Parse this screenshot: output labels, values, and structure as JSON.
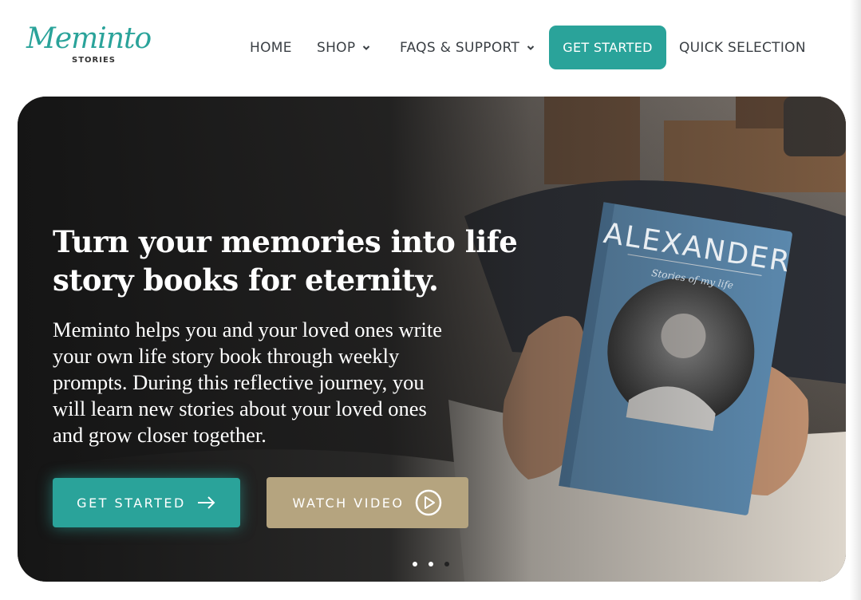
{
  "brand": {
    "logo_script": "Meminto",
    "logo_sub": "STORIES"
  },
  "nav": {
    "home": "HOME",
    "shop": "SHOP",
    "faqs": "FAQS & SUPPORT",
    "get_started": "GET STARTED",
    "quick_selection": "QUICK SELECTION"
  },
  "hero": {
    "title_line1": "Turn your memories into life",
    "title_line2": "story books for eternity.",
    "desc_lines": [
      "Meminto helps you and your loved ones write",
      "your own life story book through weekly",
      "prompts. During this reflective journey, you",
      "will learn new stories about your loved ones",
      "and grow closer together."
    ],
    "cta_primary": "GET STARTED",
    "cta_secondary": "WATCH VIDEO",
    "book_name": "ALEXANDER",
    "book_subtitle": "Stories of my life",
    "carousel_active_index": 2,
    "carousel_count": 3
  },
  "colors": {
    "accent": "#2aa39a",
    "secondary": "#b5a47f",
    "text_dark": "#3a3f44"
  },
  "icons": {
    "chevron": "chevron-down-icon",
    "arrow": "arrow-right-icon",
    "play": "play-circle-icon"
  }
}
